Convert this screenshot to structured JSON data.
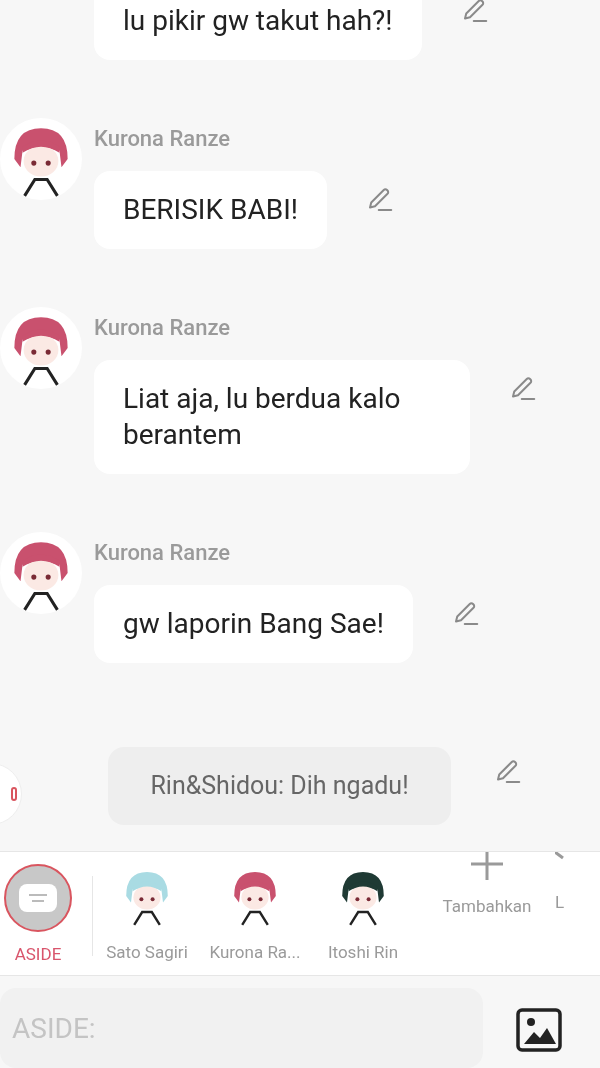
{
  "messages": [
    {
      "kind": "message",
      "text": "lu pikir gw takut hah?!"
    },
    {
      "kind": "message",
      "sender": "Kurona Ranze",
      "color": "#c9516e",
      "text": "BERISIK BABI!"
    },
    {
      "kind": "message",
      "sender": "Kurona Ranze",
      "color": "#c9516e",
      "text": "Liat aja, lu berdua kalo berantem"
    },
    {
      "kind": "message",
      "sender": "Kurona Ranze",
      "color": "#c9516e",
      "text": "gw laporin Bang Sae!"
    },
    {
      "kind": "aside",
      "text": "Rin&Shidou: Dih ngadu!"
    }
  ],
  "characters": [
    {
      "kind": "aside",
      "label": "ASIDE",
      "selected": true
    },
    {
      "kind": "character",
      "label": "Sato Sagiri",
      "color": "#a9dbe3",
      "selected": false
    },
    {
      "kind": "character",
      "label": "Kurona Ra...",
      "color": "#c9516e",
      "selected": false
    },
    {
      "kind": "character",
      "label": "Itoshi Rin",
      "color": "#1f3a34",
      "selected": false
    },
    {
      "kind": "add",
      "label": "Tambahkan"
    },
    {
      "kind": "more",
      "label": "L"
    }
  ],
  "input": {
    "placeholder": "ASIDE:"
  }
}
